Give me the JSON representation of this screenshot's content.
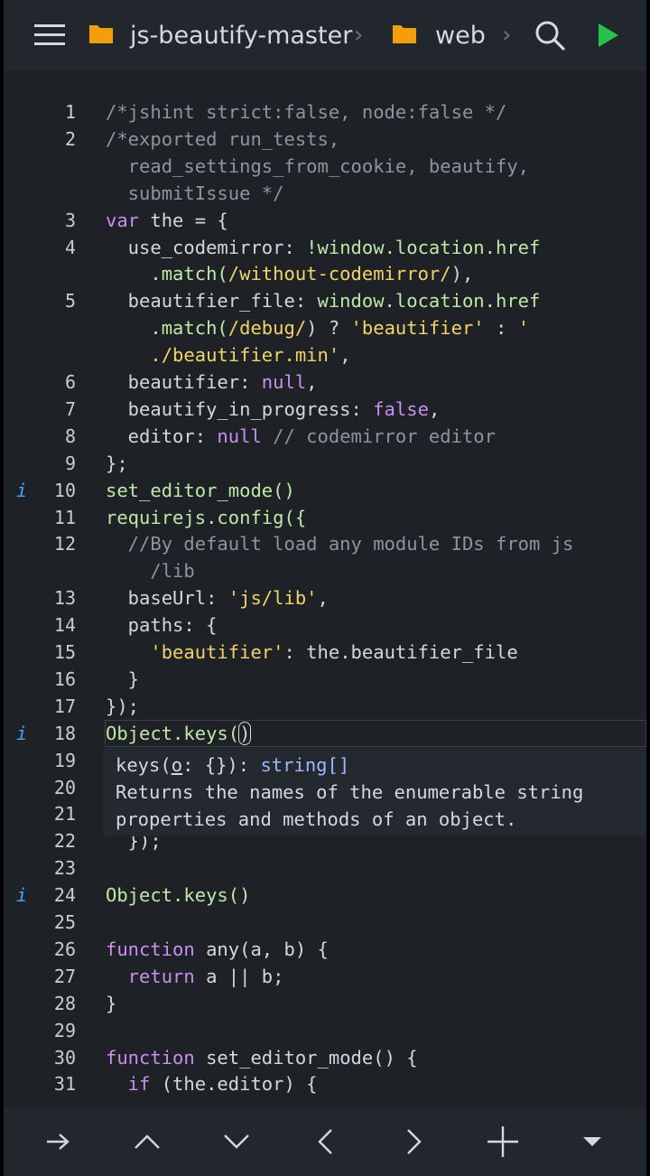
{
  "header": {
    "menu_icon": "hamburger-menu-icon",
    "breadcrumb": [
      {
        "icon": "folder-icon",
        "label": "js-beautify-master"
      },
      {
        "icon": "folder-icon",
        "label": "web"
      }
    ],
    "separator": "›",
    "actions": [
      "search-icon",
      "run-play-icon"
    ]
  },
  "editor": {
    "lines": [
      {
        "num": "1",
        "tokens": [
          [
            "/*jshint strict:false, node:false */",
            "c"
          ]
        ]
      },
      {
        "num": "2",
        "tokens": [
          [
            "/*exported run_tests,",
            "c"
          ]
        ]
      },
      {
        "num": "",
        "tokens": [
          [
            "  read_settings_from_cookie, beautify,",
            "c"
          ]
        ]
      },
      {
        "num": "",
        "tokens": [
          [
            "  submitIssue */",
            "c"
          ]
        ]
      },
      {
        "num": "3",
        "tokens": [
          [
            "var",
            "k"
          ],
          [
            " the = {",
            "p"
          ]
        ]
      },
      {
        "num": "4",
        "tokens": [
          [
            "  use_codemirror: ",
            "p"
          ],
          [
            "!window.location.href",
            "f"
          ]
        ]
      },
      {
        "num": "",
        "tokens": [
          [
            "    .match(",
            "f"
          ],
          [
            "/without-codemirror/",
            "s"
          ],
          [
            "),",
            "p"
          ]
        ]
      },
      {
        "num": "5",
        "tokens": [
          [
            "  beautifier_file: ",
            "p"
          ],
          [
            "window.location.href",
            "f"
          ]
        ]
      },
      {
        "num": "",
        "tokens": [
          [
            "    .match(",
            "f"
          ],
          [
            "/debug/",
            "s"
          ],
          [
            ") ? ",
            "p"
          ],
          [
            "'beautifier'",
            "s"
          ],
          [
            " : ",
            "p"
          ],
          [
            "'",
            "s"
          ]
        ]
      },
      {
        "num": "",
        "tokens": [
          [
            "    ./beautifier.min'",
            "s"
          ],
          [
            ",",
            "p"
          ]
        ]
      },
      {
        "num": "6",
        "tokens": [
          [
            "  beautifier: ",
            "p"
          ],
          [
            "null",
            "k"
          ],
          [
            ",",
            "p"
          ]
        ]
      },
      {
        "num": "7",
        "tokens": [
          [
            "  beautify_in_progress: ",
            "p"
          ],
          [
            "false",
            "k"
          ],
          [
            ",",
            "p"
          ]
        ]
      },
      {
        "num": "8",
        "tokens": [
          [
            "  editor: ",
            "p"
          ],
          [
            "null",
            "k"
          ],
          [
            " // codemirror editor",
            "c"
          ]
        ]
      },
      {
        "num": "9",
        "tokens": [
          [
            "};",
            "p"
          ]
        ]
      },
      {
        "num": "10",
        "info": "i",
        "tokens": [
          [
            "set_editor_mode()",
            "f"
          ]
        ]
      },
      {
        "num": "11",
        "tokens": [
          [
            "requirejs.config({",
            "f"
          ]
        ]
      },
      {
        "num": "12",
        "tokens": [
          [
            "  //By default load any module IDs from js",
            "c"
          ]
        ]
      },
      {
        "num": "",
        "tokens": [
          [
            "    /lib",
            "c"
          ]
        ]
      },
      {
        "num": "13",
        "tokens": [
          [
            "  baseUrl: ",
            "p"
          ],
          [
            "'js/lib'",
            "s"
          ],
          [
            ",",
            "p"
          ]
        ]
      },
      {
        "num": "14",
        "tokens": [
          [
            "  paths: {",
            "p"
          ]
        ]
      },
      {
        "num": "15",
        "tokens": [
          [
            "    'beautifier'",
            "s"
          ],
          [
            ": the.beautifier_file",
            "p"
          ]
        ]
      },
      {
        "num": "16",
        "tokens": [
          [
            "  }",
            "p"
          ]
        ]
      },
      {
        "num": "17",
        "tokens": [
          [
            "});",
            "p"
          ]
        ]
      },
      {
        "num": "18",
        "info": "i",
        "tokens": [
          [
            "Object.keys(",
            "f"
          ],
          [
            ")",
            "p"
          ]
        ]
      },
      {
        "num": "19",
        "tokens": []
      },
      {
        "num": "20",
        "tokens": []
      },
      {
        "num": "21",
        "tokens": []
      },
      {
        "num": "22",
        "tokens": [
          [
            "  });",
            "p"
          ]
        ]
      },
      {
        "num": "23",
        "tokens": []
      },
      {
        "num": "24",
        "info": "i",
        "tokens": [
          [
            "Object.keys()",
            "f"
          ]
        ]
      },
      {
        "num": "25",
        "tokens": []
      },
      {
        "num": "26",
        "tokens": [
          [
            "function",
            "k"
          ],
          [
            " any(a, b) {",
            "p"
          ]
        ]
      },
      {
        "num": "27",
        "tokens": [
          [
            "  return",
            "k"
          ],
          [
            " a || b;",
            "p"
          ]
        ]
      },
      {
        "num": "28",
        "tokens": [
          [
            "}",
            "p"
          ]
        ]
      },
      {
        "num": "29",
        "tokens": []
      },
      {
        "num": "30",
        "tokens": [
          [
            "function",
            "k"
          ],
          [
            " set_editor_mode() {",
            "p"
          ]
        ]
      },
      {
        "num": "31",
        "tokens": [
          [
            "  if",
            "k"
          ],
          [
            " (the.editor) {",
            "p"
          ]
        ]
      }
    ],
    "tooltip": {
      "sig_name": "keys(",
      "sig_param": "o",
      "sig_rest": ": {}): ",
      "sig_type": "string[]",
      "desc_line1": "Returns the names of the enumerable string",
      "desc_line2": "properties and methods of an object."
    }
  },
  "token_colors": {
    "c": "#8b95a1",
    "k": "#c98ef0",
    "p": "#d4d8dd",
    "f": "#bfe8a8",
    "s": "#f2d36b"
  },
  "bottombar": {
    "buttons": [
      {
        "name": "tab-indent-button",
        "glyph": "→"
      },
      {
        "name": "cursor-up-button",
        "glyph": "up"
      },
      {
        "name": "cursor-down-button",
        "glyph": "down"
      },
      {
        "name": "cursor-left-button",
        "glyph": "left"
      },
      {
        "name": "cursor-right-button",
        "glyph": "right"
      },
      {
        "name": "add-button",
        "glyph": "plus"
      },
      {
        "name": "more-menu-button",
        "glyph": "caret"
      }
    ]
  }
}
